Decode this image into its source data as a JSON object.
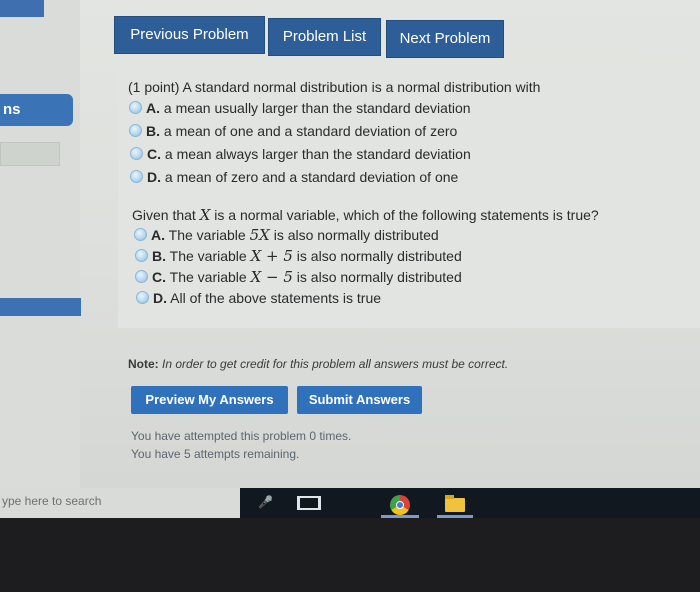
{
  "sidebar": {
    "item_fragment": "ns"
  },
  "nav": {
    "previous": "Previous Problem",
    "list": "Problem List",
    "next": "Next Problem"
  },
  "q1": {
    "prompt": "(1 point) A standard normal distribution is a normal distribution with",
    "options": [
      {
        "letter": "A.",
        "text": "a mean usually larger than the standard deviation"
      },
      {
        "letter": "B.",
        "text": "a mean of one and a standard deviation of zero"
      },
      {
        "letter": "C.",
        "text": "a mean always larger than the standard deviation"
      },
      {
        "letter": "D.",
        "text": "a mean of zero and a standard deviation of one"
      }
    ]
  },
  "q2": {
    "prompt_pre": "Given that",
    "var": "X",
    "prompt_post": "is a normal variable, which of the following statements is true?",
    "options": [
      {
        "letter": "A.",
        "pre": "The variable",
        "math": "5X",
        "post": "is also normally distributed"
      },
      {
        "letter": "B.",
        "pre": "The variable",
        "math": "X + 5",
        "post": "is also normally distributed"
      },
      {
        "letter": "C.",
        "pre": "The variable",
        "math": "X − 5",
        "post": "is also normally distributed"
      },
      {
        "letter": "D.",
        "text": "All of the above statements is true"
      }
    ]
  },
  "note": {
    "label": "Note:",
    "text": "In order to get credit for this problem all answers must be correct."
  },
  "actions": {
    "preview": "Preview My Answers",
    "submit": "Submit Answers"
  },
  "attempts": {
    "line1": "You have attempted this problem 0 times.",
    "line2": "You have 5 attempts remaining."
  },
  "taskbar": {
    "search_placeholder": "ype here to search"
  },
  "colors": {
    "accent": "#2d5e97",
    "action_button": "#2f72bb",
    "background": "#e0e2df"
  }
}
